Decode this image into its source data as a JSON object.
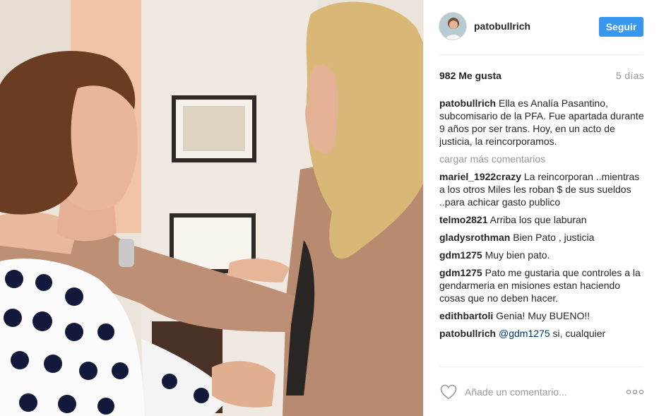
{
  "post": {
    "username": "patobullrich",
    "follow_label": "Seguir",
    "likes": "982 Me gusta",
    "age": "5 días",
    "load_more": "cargar más comentarios",
    "comment_placeholder": "Añade un comentario...",
    "comments": [
      {
        "author": "patobullrich",
        "text": " Ella es Analía Pasantino, subcomisario de la PFA. Fue apartada durante 9 años por ser trans. Hoy, en un acto de justicia, la reincorporamos."
      },
      {
        "author": "mariel_1922crazy",
        "text": " La reincorporan ..mientras a los otros Miles les roban $ de sus sueldos ..para achicar gasto publico"
      },
      {
        "author": "telmo2821",
        "text": " Arriba los que laburan"
      },
      {
        "author": "gladysrothman",
        "text": " Bien Pato , justicia"
      },
      {
        "author": "gdm1275",
        "text": " Muy bien pato."
      },
      {
        "author": "gdm1275",
        "text": " Pato me gustaria que controles a la gendarmeria en misiones estan haciendo cosas que no deben hacer."
      },
      {
        "author": "edithbartoli",
        "text": " Genia! Muy BUENO!!"
      },
      {
        "author": "patobullrich",
        "mention": "@gdm1275",
        "text": " si, cualquier"
      }
    ]
  },
  "icons": {
    "heart": "heart-outline-icon",
    "more": "more-options-icon"
  },
  "colors": {
    "follow_button": "#3897f0",
    "muted_text": "#999999",
    "mention": "#003569"
  }
}
